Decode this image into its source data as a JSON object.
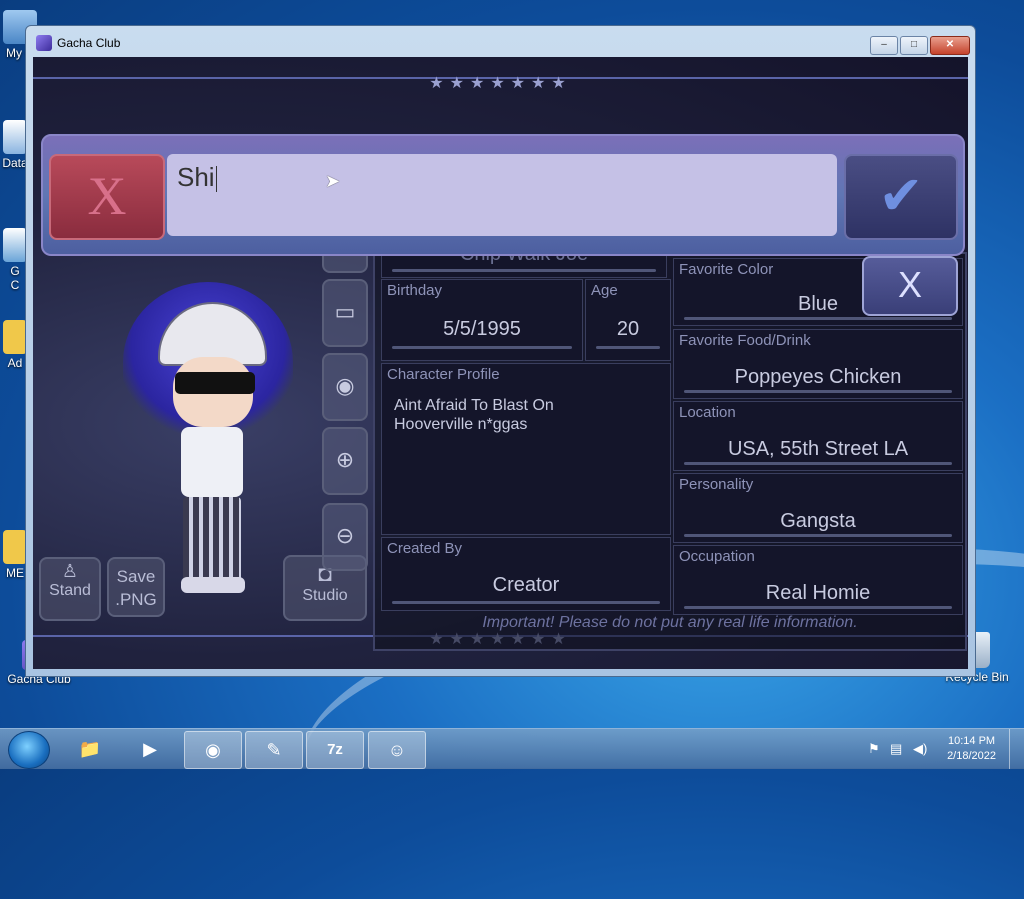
{
  "desktop": {
    "icons": [
      {
        "label": "My C",
        "name": "my-computer"
      },
      {
        "label": "Data",
        "name": "data"
      },
      {
        "label": "G\nC",
        "name": "gc"
      },
      {
        "label": "Ad",
        "name": "ad"
      },
      {
        "label": "ME",
        "name": "me"
      },
      {
        "label": "Gacha Club",
        "name": "gacha-club"
      },
      {
        "label": "Recycle Bin",
        "name": "recycle-bin"
      }
    ]
  },
  "window": {
    "title": "Gacha Club",
    "icon": "gacha-app-icon",
    "buttons": {
      "minimize": "–",
      "maximize": "□",
      "close": "✕"
    }
  },
  "game": {
    "stars": "★★★★★★★",
    "input_overlay": {
      "cancel_label": "X",
      "text_value": "Shi",
      "confirm_label": "✔"
    },
    "close_panel_label": "X",
    "partial_name": "Chip Walk Joe",
    "side_buttons": {
      "stand": "Stand",
      "save_png": "Save\n.PNG",
      "studio": "Studio"
    },
    "tool_icons": [
      "image-icon",
      "eye-icon",
      "zoom-in-icon",
      "zoom-out-icon"
    ],
    "fields": {
      "birthday": {
        "label": "Birthday",
        "value": "5/5/1995"
      },
      "age": {
        "label": "Age",
        "value": "20"
      },
      "character_profile": {
        "label": "Character Profile",
        "value": "Aint Afraid To Blast On\nHooverville n*ggas"
      },
      "created_by": {
        "label": "Created By",
        "value": "Creator"
      },
      "favorite_color": {
        "label": "Favorite Color",
        "value": "Blue"
      },
      "favorite_food": {
        "label": "Favorite Food/Drink",
        "value": "Poppeyes Chicken"
      },
      "location": {
        "label": "Location",
        "value": "USA, 55th Street LA"
      },
      "personality": {
        "label": "Personality",
        "value": "Gangsta"
      },
      "occupation": {
        "label": "Occupation",
        "value": "Real Homie"
      }
    },
    "important_note": "Important! Please do not put any real life information."
  },
  "taskbar": {
    "items": [
      {
        "name": "explorer-taskbar-icon",
        "glyph": "📁"
      },
      {
        "name": "media-player-taskbar-icon",
        "glyph": "▶"
      },
      {
        "name": "chrome-taskbar-icon",
        "glyph": "◉"
      },
      {
        "name": "notepad-taskbar-icon",
        "glyph": "✎"
      },
      {
        "name": "7zip-taskbar-icon",
        "glyph": "7z"
      },
      {
        "name": "gacha-club-taskbar-icon",
        "glyph": "☺"
      }
    ],
    "time": "10:14 PM",
    "date": "2/18/2022"
  }
}
